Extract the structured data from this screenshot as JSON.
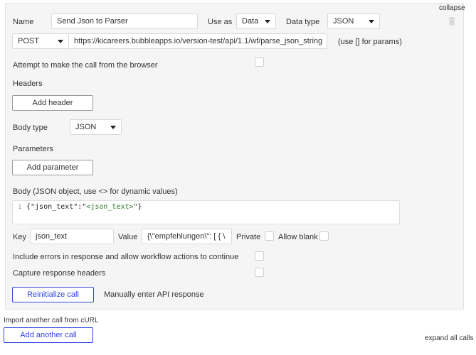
{
  "call": {
    "collapse_link": "collapse",
    "name_label": "Name",
    "name_value": "Send Json to Parser",
    "use_as_label": "Use as",
    "use_as_value": "Data",
    "data_type_label": "Data type",
    "data_type_value": "JSON",
    "trash_icon": "trash-icon",
    "method_value": "POST",
    "url_value": "https://kicareers.bubbleapps.io/version-test/api/1.1/wf/parse_json_string",
    "url_hint": "(use [] for params)",
    "browser_call_label": "Attempt to make the call from the browser",
    "headers_label": "Headers",
    "add_header_button": "Add header",
    "body_type_label": "Body type",
    "body_type_value": "JSON",
    "parameters_label": "Parameters",
    "add_parameter_button": "Add parameter",
    "body_label": "Body (JSON object, use <> for dynamic values)",
    "code": {
      "line_number": "1",
      "prefix": "{\"json_text\":\"",
      "placeholder": "<json_text>",
      "suffix": "\"}"
    },
    "key_label": "Key",
    "key_value": "json_text",
    "value_label": "Value",
    "value_value": "{\\\"empfehlungen\\\": [  {   \\",
    "private_label": "Private",
    "allow_blank_label": "Allow blank",
    "include_errors_label": "Include errors in response and allow workflow actions to continue",
    "capture_headers_label": "Capture response headers",
    "reinitialize_button": "Reinitialize call",
    "manual_response_link": "Manually enter API response"
  },
  "footer": {
    "import_curl_link": "Import another call from cURL",
    "add_call_button": "Add another call",
    "expand_all_link": "expand all calls"
  },
  "colors": {
    "panel_bg": "#f5f5f5",
    "accent_blue": "#2f46e0",
    "placeholder_green": "#2a7a2a"
  }
}
